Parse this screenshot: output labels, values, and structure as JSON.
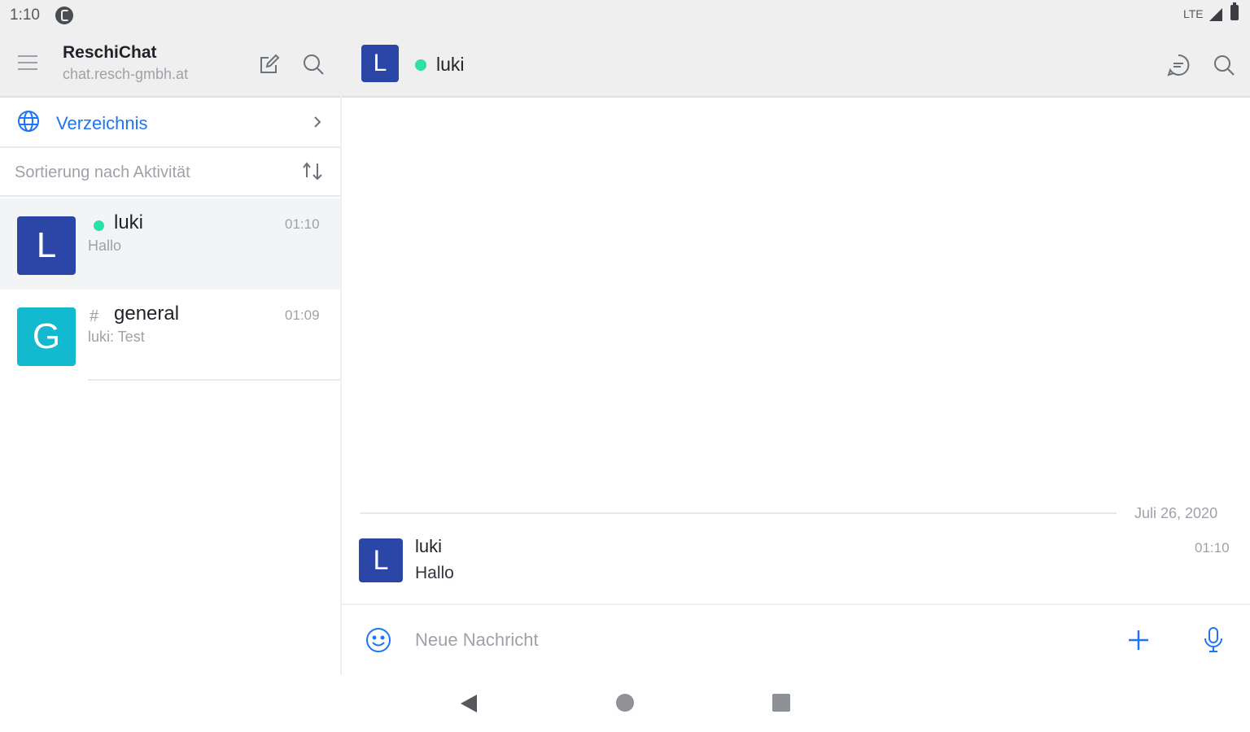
{
  "status_bar": {
    "time": "1:10",
    "network": "LTE",
    "icons": [
      "notification-icon",
      "signal-icon",
      "battery-icon"
    ]
  },
  "server": {
    "name": "ReschiChat",
    "host": "chat.resch-gmbh.at"
  },
  "sidebar": {
    "directory_label": "Verzeichnis",
    "sort_label": "Sortierung nach Aktivität",
    "rooms": [
      {
        "initial": "L",
        "name": "luki",
        "preview": "Hallo",
        "time": "01:10",
        "color": "#2c46a8",
        "online": true,
        "type": "direct",
        "active": true
      },
      {
        "initial": "G",
        "name": "general",
        "prefix": "#",
        "preview": "luki: Test",
        "time": "01:09",
        "color": "#12b9cf",
        "online": false,
        "type": "channel",
        "active": false
      }
    ]
  },
  "room_header": {
    "initial": "L",
    "name": "luki",
    "status_color": "#2de0a5"
  },
  "messages": {
    "date": "Juli 26, 2020",
    "items": [
      {
        "initial": "L",
        "author": "luki",
        "text": "Hallo",
        "time": "01:10"
      }
    ]
  },
  "composer": {
    "placeholder": "Neue Nachricht"
  },
  "colors": {
    "accent": "#1d74f5",
    "online": "#2de0a5",
    "header_bg": "#efeff0",
    "muted_text": "#9ea2a8"
  }
}
